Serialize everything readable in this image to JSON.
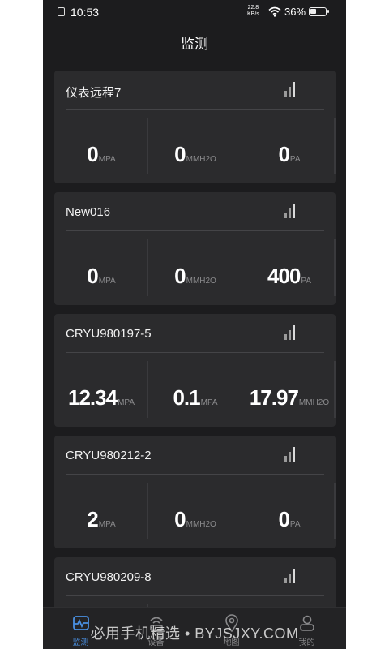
{
  "status": {
    "time": "10:53",
    "speed_top": "22.8",
    "speed_unit": "KB/s",
    "battery": "36%"
  },
  "header": {
    "title": "监测"
  },
  "cards": [
    {
      "name": "仪表远程7",
      "values": [
        {
          "num": "0",
          "unit": "MPA"
        },
        {
          "num": "0",
          "unit": "MMH2O"
        },
        {
          "num": "0",
          "unit": "PA"
        }
      ]
    },
    {
      "name": "New016",
      "values": [
        {
          "num": "0",
          "unit": "MPA"
        },
        {
          "num": "0",
          "unit": "MMH2O"
        },
        {
          "num": "400",
          "unit": "PA"
        }
      ]
    },
    {
      "name": "CRYU980197-5",
      "values": [
        {
          "num": "12.34",
          "unit": "MPA"
        },
        {
          "num": "0.1",
          "unit": "MPA"
        },
        {
          "num": "17.97",
          "unit": "MMH2O"
        }
      ]
    },
    {
      "name": "CRYU980212-2",
      "values": [
        {
          "num": "2",
          "unit": "MPA"
        },
        {
          "num": "0",
          "unit": "MMH2O"
        },
        {
          "num": "0",
          "unit": "PA"
        }
      ]
    },
    {
      "name": "CRYU980209-8",
      "values": []
    }
  ],
  "tabs": [
    {
      "label": "监测",
      "icon": "monitor-wave-icon",
      "active": true
    },
    {
      "label": "设备",
      "icon": "device-wifi-icon",
      "active": false
    },
    {
      "label": "地图",
      "icon": "map-pin-icon",
      "active": false
    },
    {
      "label": "我的",
      "icon": "profile-icon",
      "active": false
    }
  ],
  "watermark": "必用手机精选 • BYJSJXY.COM",
  "colors": {
    "background": "#1c1c1e",
    "card": "#2b2b2d",
    "accent": "#4a90e2",
    "unit_text": "#8a8a8c"
  }
}
